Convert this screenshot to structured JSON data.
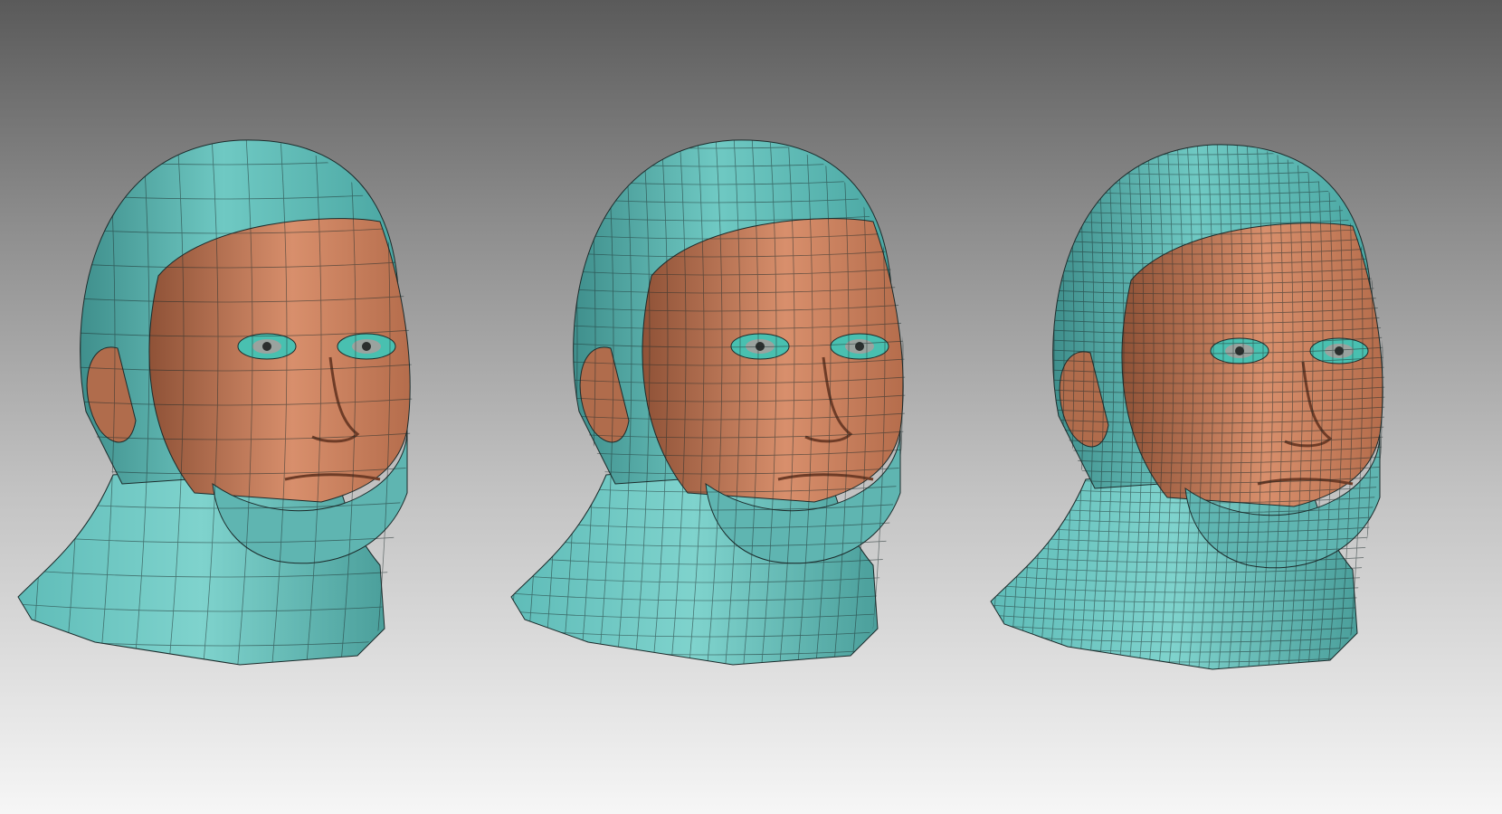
{
  "scene": {
    "description_visible_text": "",
    "colors": {
      "background_top": "#5a5a5a",
      "background_bottom": "#f6f6f6",
      "polygroup_teal": "#5fbcb8",
      "polygroup_teal_light": "#7fd3cd",
      "polygroup_teal_dark": "#3f8f8c",
      "polygroup_skin": "#c9805f",
      "polygroup_skin_light": "#e09a78",
      "polygroup_skin_dark": "#8f5237",
      "wire": "#1c2b2b"
    },
    "heads": [
      {
        "id": "low",
        "subdivision_level": 1,
        "icon": "head-mesh-lowpoly"
      },
      {
        "id": "mid",
        "subdivision_level": 2,
        "icon": "head-mesh-midpoly"
      },
      {
        "id": "high",
        "subdivision_level": 3,
        "icon": "head-mesh-sculpted"
      }
    ]
  }
}
